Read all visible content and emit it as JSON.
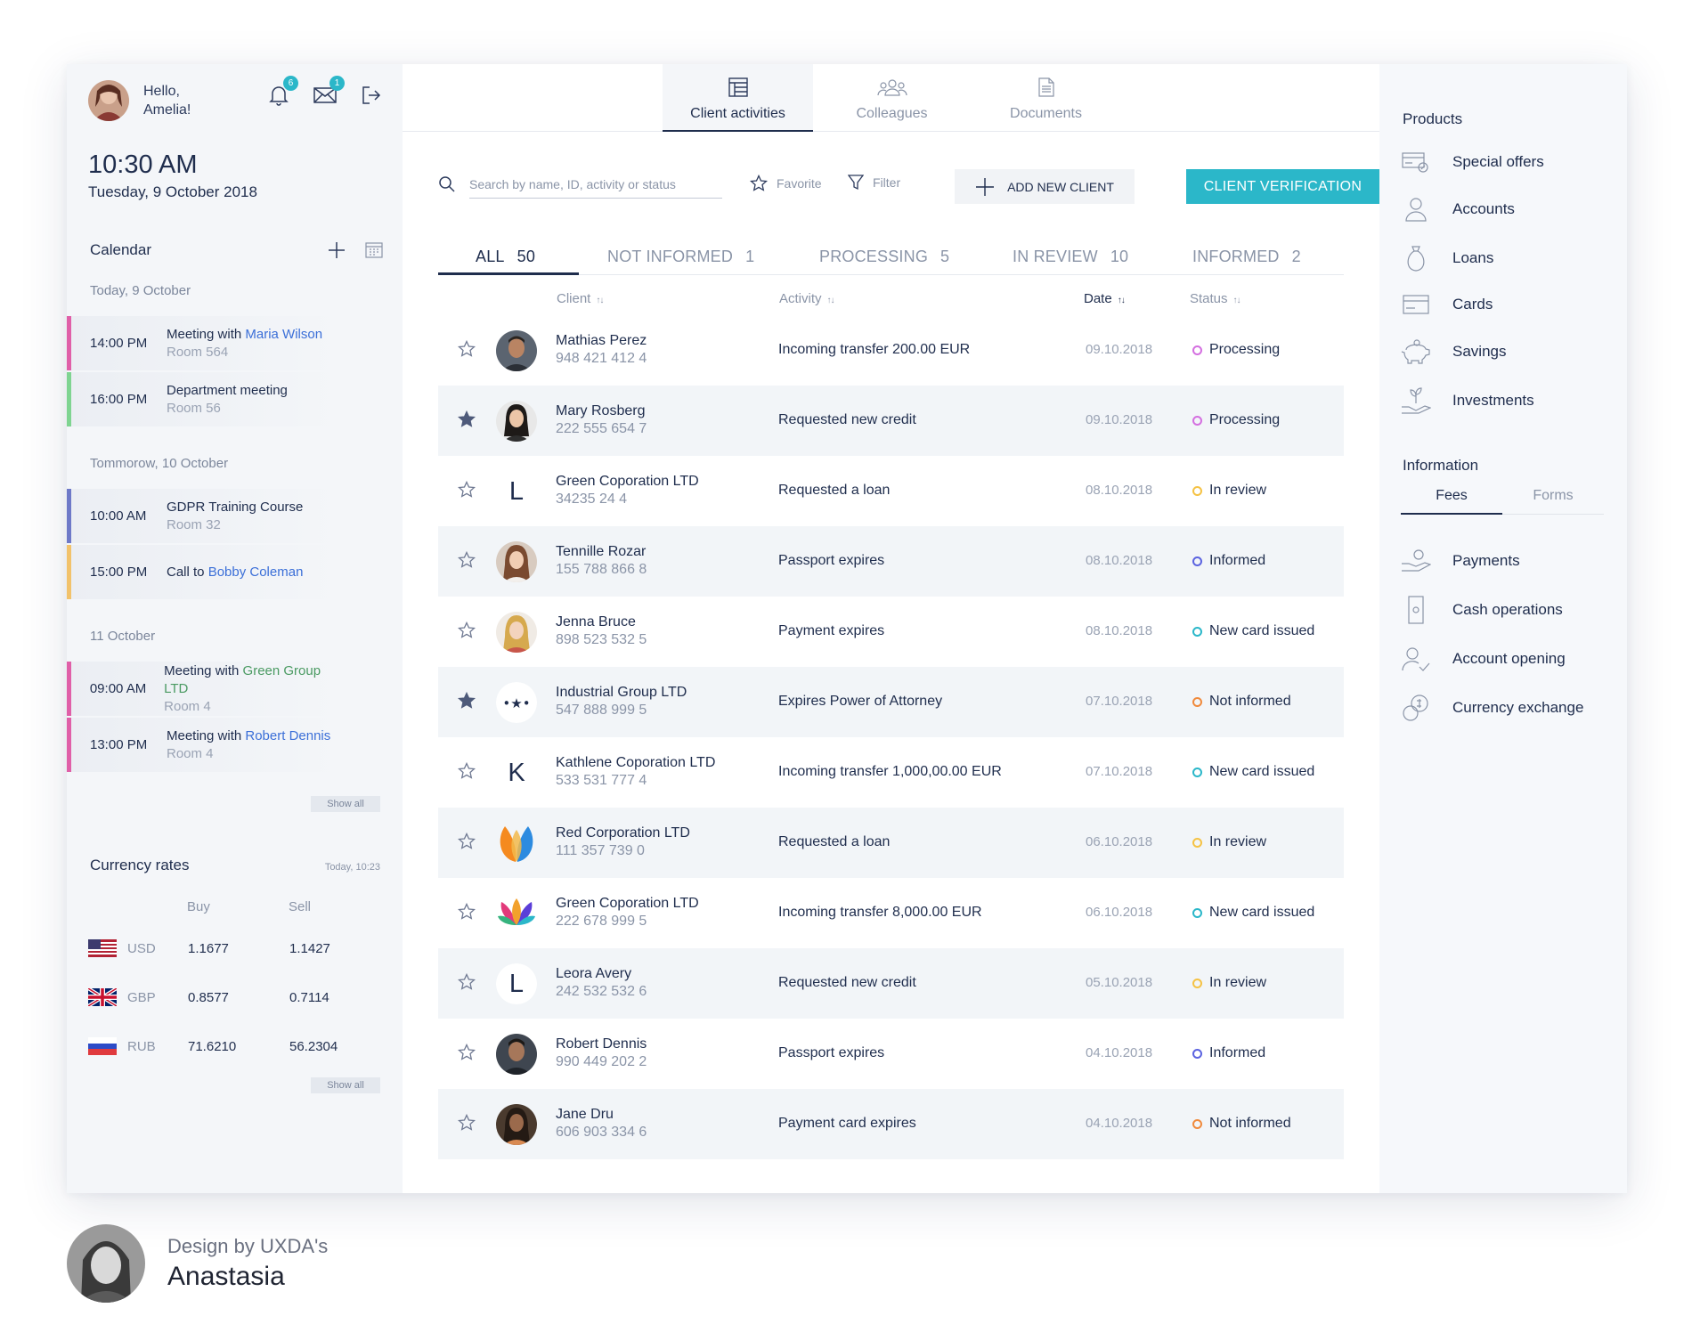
{
  "user": {
    "greeting": "Hello,",
    "name": "Amelia!",
    "notifications": "6",
    "messages": "1"
  },
  "clock": {
    "time": "10:30 AM",
    "date": "Tuesday, 9 October 2018"
  },
  "calendar": {
    "title": "Calendar",
    "show_all": "Show all",
    "days": [
      {
        "label": "Today, 9 October",
        "events": [
          {
            "time": "14:00 PM",
            "title": "Meeting with ",
            "link": "Maria Wilson",
            "room": "Room 564",
            "color": "#e05fa8"
          },
          {
            "time": "16:00 PM",
            "title": "Department meeting",
            "link": "",
            "room": "Room 56",
            "color": "#7fd491"
          }
        ]
      },
      {
        "label": "Tommorow, 10 October",
        "events": [
          {
            "time": "10:00 AM",
            "title": "GDPR Training Course",
            "link": "",
            "room": "Room 32",
            "color": "#6e79c8"
          },
          {
            "time": "15:00 PM",
            "title": "Call to ",
            "link": "Bobby Coleman",
            "room": "",
            "color": "#f2c26b"
          }
        ]
      },
      {
        "label": "11 October",
        "events": [
          {
            "time": "09:00 AM",
            "title": "Meeting with ",
            "link": "Green Group LTD",
            "room": "Room 4",
            "color": "#e05fa8"
          },
          {
            "time": "13:00 PM",
            "title": "Meeting with ",
            "link": "Robert Dennis",
            "room": "Room 4",
            "color": "#e05fa8"
          }
        ]
      }
    ]
  },
  "currency": {
    "title": "Currency rates",
    "timestamp": "Today, 10:23",
    "buy_label": "Buy",
    "sell_label": "Sell",
    "show_all": "Show all",
    "rows": [
      {
        "code": "USD",
        "buy": "1.1677",
        "sell": "1.1427"
      },
      {
        "code": "GBP",
        "buy": "0.8577",
        "sell": "0.7114"
      },
      {
        "code": "RUB",
        "buy": "71.6210",
        "sell": "56.2304"
      }
    ]
  },
  "top_tabs": [
    {
      "label": "Client activities",
      "icon": "table-icon"
    },
    {
      "label": "Colleagues",
      "icon": "people-icon"
    },
    {
      "label": "Documents",
      "icon": "document-icon"
    }
  ],
  "toolbar": {
    "search_placeholder": "Search by name, ID, activity or status",
    "favorite": "Favorite",
    "filter": "Filter",
    "add_client": "ADD NEW CLIENT",
    "verification": "CLIENT VERIFICATION"
  },
  "status_tabs": [
    {
      "label": "ALL",
      "count": "50"
    },
    {
      "label": "NOT INFORMED",
      "count": "1"
    },
    {
      "label": "PROCESSING",
      "count": "5"
    },
    {
      "label": "IN REVIEW",
      "count": "10"
    },
    {
      "label": "INFORMED",
      "count": "2"
    }
  ],
  "table": {
    "headers": {
      "client": "Client",
      "activity": "Activity",
      "date": "Date",
      "status": "Status"
    },
    "rows": [
      {
        "starred": false,
        "avatar": "photo-man-1",
        "name": "Mathias Perez",
        "id": "948 421 412 4",
        "activity": "Incoming transfer 200.00 EUR",
        "date": "09.10.2018",
        "status": "Processing",
        "status_color": "#d46fe0"
      },
      {
        "starred": true,
        "avatar": "photo-woman-1",
        "name": "Mary Rosberg",
        "id": "222 555 654 7",
        "activity": "Requested new credit",
        "date": "09.10.2018",
        "status": "Processing",
        "status_color": "#d46fe0"
      },
      {
        "starred": false,
        "avatar": "letter",
        "letter": "L",
        "name": "Green Coporation LTD",
        "id": "34235 24 4",
        "activity": "Requested a loan",
        "date": "08.10.2018",
        "status": "In review",
        "status_color": "#f5c244"
      },
      {
        "starred": false,
        "avatar": "photo-woman-2",
        "name": "Tennille Rozar",
        "id": "155 788 866 8",
        "activity": "Passport expires",
        "date": "08.10.2018",
        "status": "Informed",
        "status_color": "#5b63e0"
      },
      {
        "starred": false,
        "avatar": "photo-woman-3",
        "name": "Jenna Bruce",
        "id": "898 523 532 5",
        "activity": "Payment expires",
        "date": "08.10.2018",
        "status": "New card issued",
        "status_color": "#2bb7c9"
      },
      {
        "starred": true,
        "avatar": "stars-logo",
        "name": "Industrial Group LTD",
        "id": "547 888 999 5",
        "activity": "Expires Power of Attorney",
        "date": "07.10.2018",
        "status": "Not informed",
        "status_color": "#f08a3c"
      },
      {
        "starred": false,
        "avatar": "letter",
        "letter": "K",
        "name": "Kathlene Coporation LTD",
        "id": "533 531 777 4",
        "activity": "Incoming transfer 1,000,00.00 EUR",
        "date": "07.10.2018",
        "status": "New card issued",
        "status_color": "#2bb7c9"
      },
      {
        "starred": false,
        "avatar": "petals-logo",
        "name": "Red Corporation LTD",
        "id": "111 357 739 0",
        "activity": "Requested a loan",
        "date": "06.10.2018",
        "status": "In review",
        "status_color": "#f5c244"
      },
      {
        "starred": false,
        "avatar": "flower-logo",
        "name": "Green Coporation LTD",
        "id": "222 678 999 5",
        "activity": "Incoming transfer 8,000.00 EUR",
        "date": "06.10.2018",
        "status": "New card issued",
        "status_color": "#2bb7c9"
      },
      {
        "starred": false,
        "avatar": "letter",
        "letter": "L",
        "name": "Leora Avery",
        "id": "242 532 532 6",
        "activity": "Requested new credit",
        "date": "05.10.2018",
        "status": "In review",
        "status_color": "#f5c244"
      },
      {
        "starred": false,
        "avatar": "photo-man-2",
        "name": "Robert Dennis",
        "id": "990 449 202 2",
        "activity": "Passport expires",
        "date": "04.10.2018",
        "status": "Informed",
        "status_color": "#5b63e0"
      },
      {
        "starred": false,
        "avatar": "photo-woman-4",
        "name": "Jane Dru",
        "id": "606 903 334 6",
        "activity": "Payment card expires",
        "date": "04.10.2018",
        "status": "Not informed",
        "status_color": "#f08a3c"
      }
    ]
  },
  "products": {
    "title": "Products",
    "items": [
      {
        "label": "Special offers",
        "icon": "offer-icon"
      },
      {
        "label": "Accounts",
        "icon": "person-icon"
      },
      {
        "label": "Loans",
        "icon": "money-bag-icon"
      },
      {
        "label": "Cards",
        "icon": "card-icon"
      },
      {
        "label": "Savings",
        "icon": "piggy-bank-icon"
      },
      {
        "label": "Investments",
        "icon": "plant-hand-icon"
      }
    ]
  },
  "information": {
    "title": "Information",
    "tabs": [
      "Fees",
      "Forms"
    ],
    "items": [
      {
        "label": "Payments",
        "icon": "hand-coin-icon"
      },
      {
        "label": "Cash operations",
        "icon": "phone-icon"
      },
      {
        "label": "Account opening",
        "icon": "person-check-icon"
      },
      {
        "label": "Currency exchange",
        "icon": "coins-icon"
      }
    ]
  },
  "credit": {
    "line1": "Design by UXDA's",
    "line2": "Anastasia"
  }
}
